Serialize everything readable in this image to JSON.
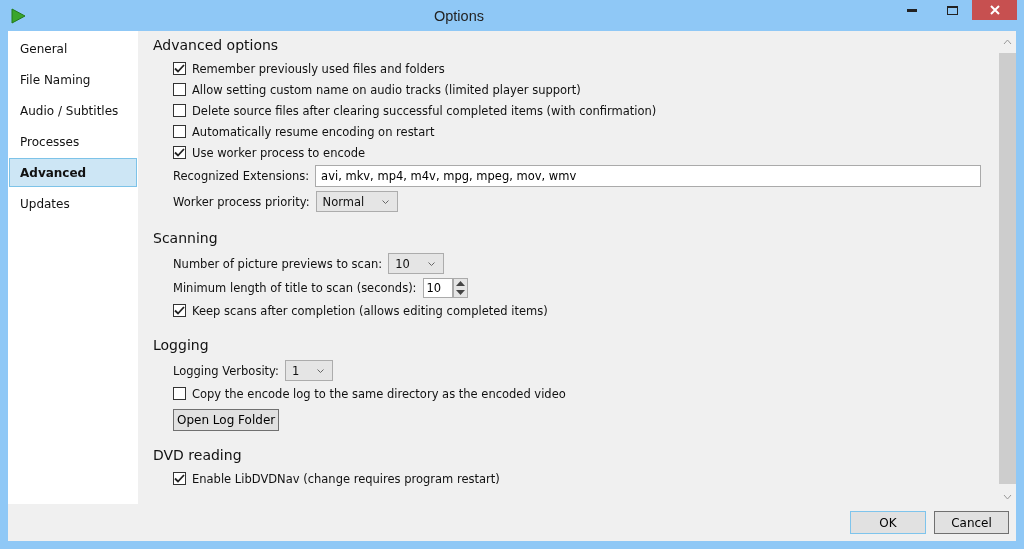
{
  "window": {
    "title": "Options"
  },
  "sidebar": {
    "items": [
      {
        "label": "General",
        "selected": false
      },
      {
        "label": "File Naming",
        "selected": false
      },
      {
        "label": "Audio / Subtitles",
        "selected": false
      },
      {
        "label": "Processes",
        "selected": false
      },
      {
        "label": "Advanced",
        "selected": true
      },
      {
        "label": "Updates",
        "selected": false
      }
    ]
  },
  "sections": [
    {
      "title": "Advanced options",
      "items": [
        {
          "kind": "checkbox",
          "label": "Remember previously used files and folders",
          "checked": true
        },
        {
          "kind": "checkbox",
          "label": "Allow setting custom name on audio tracks (limited player support)",
          "checked": false
        },
        {
          "kind": "checkbox",
          "label": "Delete source files after clearing successful completed items (with confirmation)",
          "checked": false
        },
        {
          "kind": "checkbox",
          "label": "Automatically resume encoding on restart",
          "checked": false
        },
        {
          "kind": "checkbox",
          "label": "Use worker process to encode",
          "checked": true
        },
        {
          "kind": "text",
          "label": "Recognized Extensions:",
          "value": "avi, mkv, mp4, m4v, mpg, mpeg, mov, wmv"
        },
        {
          "kind": "dropdown",
          "label": "Worker process priority:",
          "value": "Normal"
        }
      ]
    },
    {
      "title": "Scanning",
      "items": [
        {
          "kind": "dropdown",
          "label": "Number of picture previews to scan:",
          "value": "10"
        },
        {
          "kind": "spinner",
          "label": "Minimum length of title to scan (seconds):",
          "value": "10"
        },
        {
          "kind": "checkbox",
          "label": "Keep scans after completion (allows editing completed items)",
          "checked": true
        }
      ]
    },
    {
      "title": "Logging",
      "items": [
        {
          "kind": "dropdown",
          "label": "Logging Verbosity:",
          "value": "1"
        },
        {
          "kind": "checkbox",
          "label": "Copy the encode log to the same directory as the encoded video",
          "checked": false
        },
        {
          "kind": "button",
          "label": "Open Log Folder"
        }
      ]
    },
    {
      "title": "DVD reading",
      "items": [
        {
          "kind": "checkbox",
          "label": "Enable LibDVDNav (change requires program restart)",
          "checked": true
        }
      ]
    }
  ],
  "buttons": [
    {
      "label": "OK",
      "default": true
    },
    {
      "label": "Cancel",
      "default": false
    }
  ]
}
